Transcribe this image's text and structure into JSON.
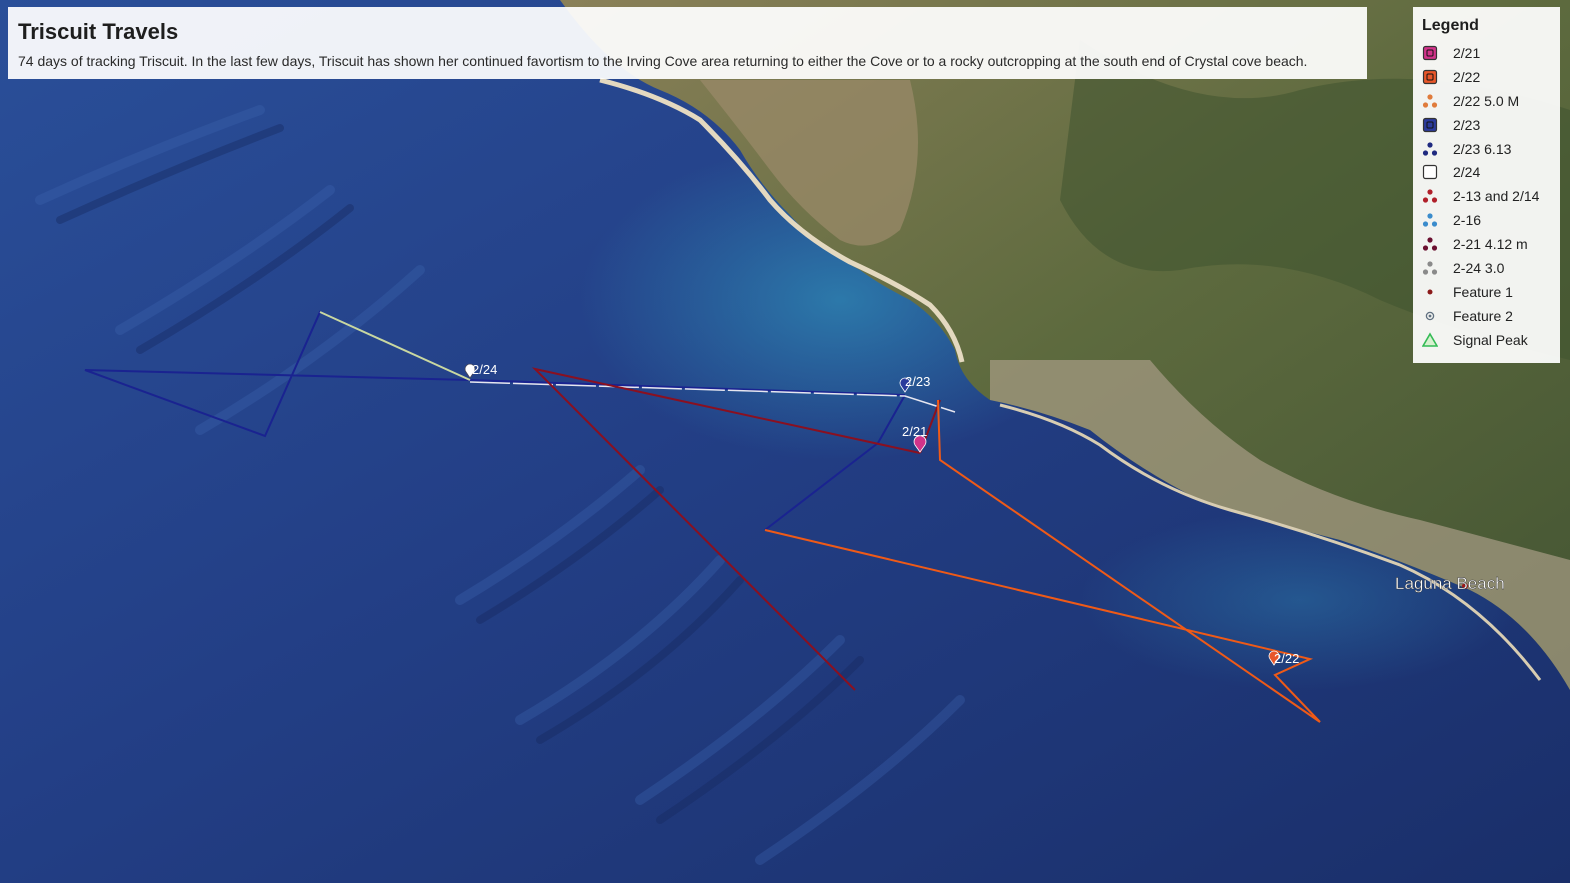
{
  "panel": {
    "title": "Triscuit Travels",
    "description": "74 days of tracking Triscuit. In the last few days, Triscuit has shown her continued favortism to the Irving Cove area returning to either the Cove or to a rocky outcropping at the south end of Crystal cove beach."
  },
  "legend": {
    "title": "Legend",
    "items": [
      {
        "label": "2/21",
        "symbol": "pin-square",
        "color": "#d1338a"
      },
      {
        "label": "2/22",
        "symbol": "pin-square",
        "color": "#e8562a"
      },
      {
        "label": "2/22 5.0 M",
        "symbol": "line-track",
        "color": "#e07b3c"
      },
      {
        "label": "2/23",
        "symbol": "pin-square",
        "color": "#2b3a9c"
      },
      {
        "label": "2/23 6.13",
        "symbol": "line-track",
        "color": "#1f2a80"
      },
      {
        "label": "2/24",
        "symbol": "pin-square",
        "color": "#ffffff"
      },
      {
        "label": "2-13 and 2/14",
        "symbol": "line-track",
        "color": "#b0202a"
      },
      {
        "label": "2-16",
        "symbol": "line-track",
        "color": "#3a8ccc"
      },
      {
        "label": "2-21 4.12 m",
        "symbol": "line-track",
        "color": "#6b1030"
      },
      {
        "label": "2-24 3.0",
        "symbol": "line-track",
        "color": "#8a8a8a"
      },
      {
        "label": "Feature 1",
        "symbol": "dot",
        "color": "#8b1a1a"
      },
      {
        "label": "Feature 2",
        "symbol": "ring-dot",
        "color": "#607080"
      },
      {
        "label": "Signal Peak",
        "symbol": "triangle",
        "color": "#33bb55"
      }
    ]
  },
  "map": {
    "town_label": "Laguna Beach",
    "markers": [
      {
        "label": "2/24"
      },
      {
        "label": "2/23"
      },
      {
        "label": "2/21"
      },
      {
        "label": "2/22"
      }
    ]
  }
}
